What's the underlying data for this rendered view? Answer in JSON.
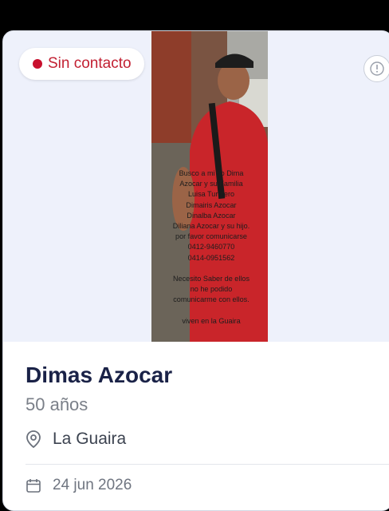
{
  "card": {
    "status_label": "Sin contacto",
    "status_color": "#c8102e",
    "info_icon": "info-icon",
    "name": "Dimas Azocar",
    "age": "50 años",
    "location": "La Guaira",
    "date": "24 jun 2026",
    "photo_note": "Busco a mi tio Dima\nAzocar y su Familia\nLuisa Turmero\nDimairis Azocar\nDinalba Azocar\nDiliana Azocar y su hijo.\npor favor comunicarse\n0412-9460770\n0414-0951562\n\nNecesito Saber de ellos\nno he podido\ncomunicarme con ellos.\n\nviven en la Guaira"
  }
}
